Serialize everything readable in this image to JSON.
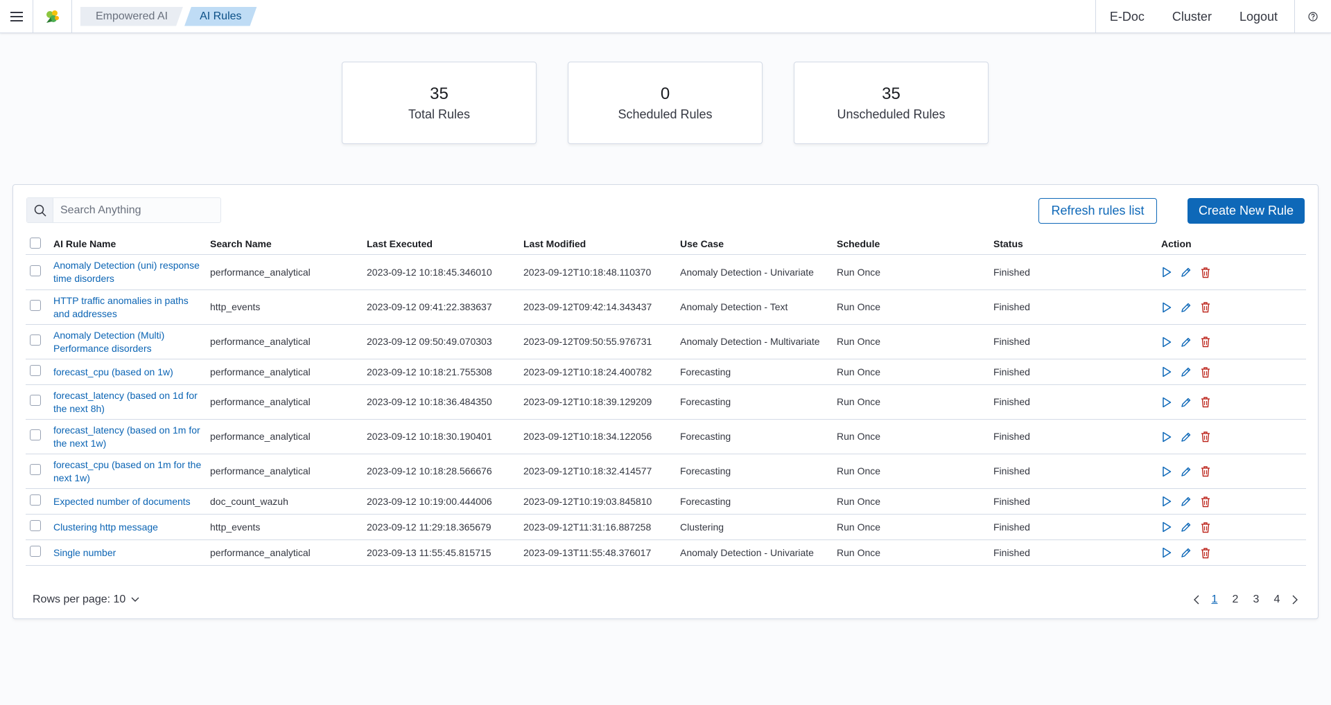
{
  "topbar": {
    "breadcrumbs": [
      "Empowered AI",
      "AI Rules"
    ],
    "nav": [
      "E-Doc",
      "Cluster",
      "Logout"
    ]
  },
  "stats": [
    {
      "value": "35",
      "label": "Total Rules"
    },
    {
      "value": "0",
      "label": "Scheduled Rules"
    },
    {
      "value": "35",
      "label": "Unscheduled Rules"
    }
  ],
  "toolbar": {
    "search_placeholder": "Search Anything",
    "refresh_label": "Refresh rules list",
    "create_label": "Create New Rule"
  },
  "table": {
    "columns": [
      "AI Rule Name",
      "Search Name",
      "Last Executed",
      "Last Modified",
      "Use Case",
      "Schedule",
      "Status",
      "Action"
    ],
    "rows": [
      {
        "name": "Anomaly Detection (uni) response time disorders",
        "search": "performance_analytical",
        "executed": "2023-09-12 10:18:45.346010",
        "modified": "2023-09-12T10:18:48.110370",
        "use_case": "Anomaly Detection - Univariate",
        "schedule": "Run Once",
        "status": "Finished"
      },
      {
        "name": "HTTP traffic anomalies in paths and addresses",
        "search": "http_events",
        "executed": "2023-09-12 09:41:22.383637",
        "modified": "2023-09-12T09:42:14.343437",
        "use_case": "Anomaly Detection - Text",
        "schedule": "Run Once",
        "status": "Finished"
      },
      {
        "name": "Anomaly Detection (Multi) Performance disorders",
        "search": "performance_analytical",
        "executed": "2023-09-12 09:50:49.070303",
        "modified": "2023-09-12T09:50:55.976731",
        "use_case": "Anomaly Detection - Multivariate",
        "schedule": "Run Once",
        "status": "Finished"
      },
      {
        "name": "forecast_cpu (based on 1w)",
        "search": "performance_analytical",
        "executed": "2023-09-12 10:18:21.755308",
        "modified": "2023-09-12T10:18:24.400782",
        "use_case": "Forecasting",
        "schedule": "Run Once",
        "status": "Finished"
      },
      {
        "name": "forecast_latency (based on 1d for the next 8h)",
        "search": "performance_analytical",
        "executed": "2023-09-12 10:18:36.484350",
        "modified": "2023-09-12T10:18:39.129209",
        "use_case": "Forecasting",
        "schedule": "Run Once",
        "status": "Finished"
      },
      {
        "name": "forecast_latency (based on 1m for the next 1w)",
        "search": "performance_analytical",
        "executed": "2023-09-12 10:18:30.190401",
        "modified": "2023-09-12T10:18:34.122056",
        "use_case": "Forecasting",
        "schedule": "Run Once",
        "status": "Finished"
      },
      {
        "name": "forecast_cpu (based on 1m for the next 1w)",
        "search": "performance_analytical",
        "executed": "2023-09-12 10:18:28.566676",
        "modified": "2023-09-12T10:18:32.414577",
        "use_case": "Forecasting",
        "schedule": "Run Once",
        "status": "Finished"
      },
      {
        "name": "Expected number of documents",
        "search": "doc_count_wazuh",
        "executed": "2023-09-12 10:19:00.444006",
        "modified": "2023-09-12T10:19:03.845810",
        "use_case": "Forecasting",
        "schedule": "Run Once",
        "status": "Finished"
      },
      {
        "name": "Clustering http message",
        "search": "http_events",
        "executed": "2023-09-12 11:29:18.365679",
        "modified": "2023-09-12T11:31:16.887258",
        "use_case": "Clustering",
        "schedule": "Run Once",
        "status": "Finished"
      },
      {
        "name": "Single number",
        "search": "performance_analytical",
        "executed": "2023-09-13 11:55:45.815715",
        "modified": "2023-09-13T11:55:48.376017",
        "use_case": "Anomaly Detection - Univariate",
        "schedule": "Run Once",
        "status": "Finished"
      }
    ]
  },
  "footer": {
    "rows_per_page": "Rows per page: 10",
    "pages": [
      "1",
      "2",
      "3",
      "4"
    ],
    "current_page": "1"
  },
  "colors": {
    "accent": "#0e68b8",
    "link": "#0b64b4",
    "play": "#0e68b8",
    "edit": "#0e68b8",
    "delete": "#bd271e"
  }
}
